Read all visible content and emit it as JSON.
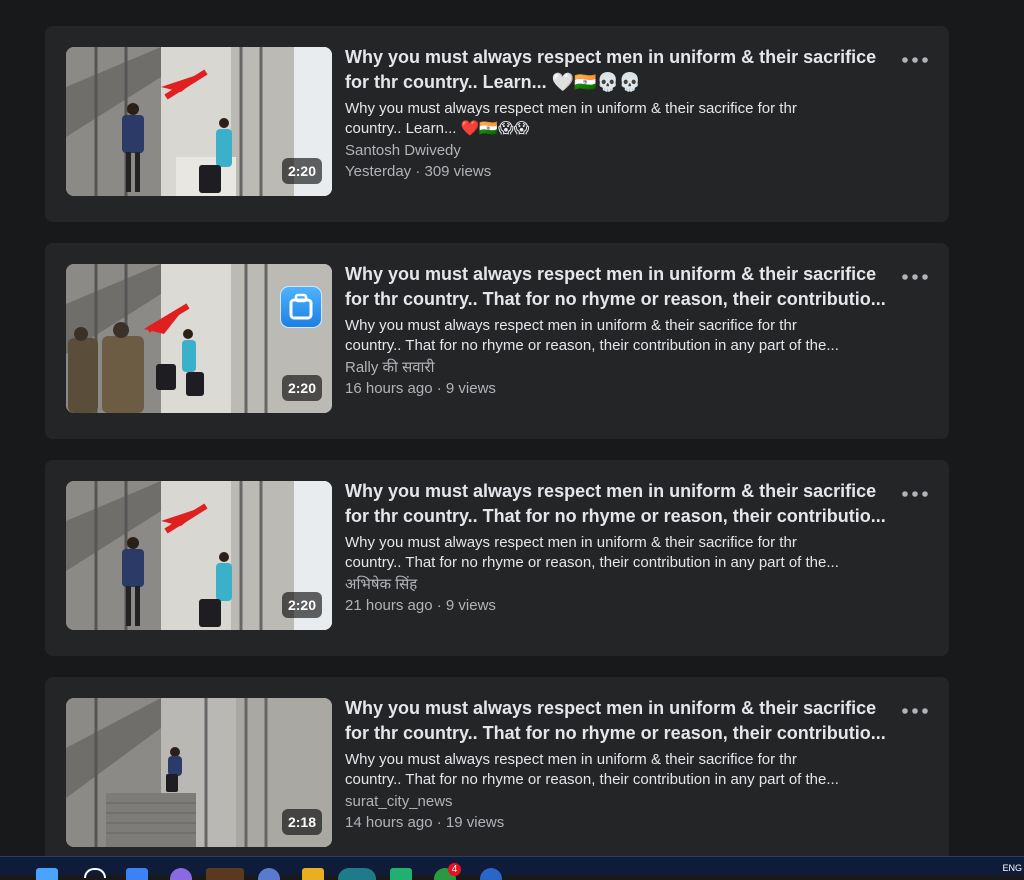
{
  "videos": [
    {
      "title": "Why you must always respect men in uniform & their sacrifice for thr country.. Learn... 🤍🇮🇳💀💀",
      "title_line1": "Why you must always respect men in uniform & their sacrifice",
      "title_line2": "for thr country.. Learn... 🤍🇮🇳💀💀",
      "desc_line1": "Why you must always respect men in uniform & their sacrifice for thr",
      "desc_line2": "country.. Learn... ❤️🇮🇳😱😱",
      "channel": "Santosh Dwivedy",
      "meta": "Yesterday · 309 views",
      "duration": "2:20"
    },
    {
      "title_line1": "Why you must always respect men in uniform & their sacrifice",
      "title_line2": "for thr country.. That for no rhyme or reason, their contributio...",
      "desc_line1": "Why you must always respect men in uniform & their sacrifice for thr",
      "desc_line2": "country.. That for no rhyme or reason, their contribution in any part of the...",
      "channel": "Rally की सवारी",
      "meta": "16 hours ago · 9 views",
      "duration": "2:20"
    },
    {
      "title_line1": "Why you must always respect men in uniform & their sacrifice",
      "title_line2": "for thr country.. That for no rhyme or reason, their contributio...",
      "desc_line1": "Why you must always respect men in uniform & their sacrifice for thr",
      "desc_line2": "country.. That for no rhyme or reason, their contribution in any part of the...",
      "channel": "अभिषेक सिंह",
      "meta": "21 hours ago · 9 views",
      "duration": "2:20"
    },
    {
      "title_line1": "Why you must always respect men in uniform & their sacrifice",
      "title_line2": "for thr country.. That for no rhyme or reason, their contributio...",
      "desc_line1": "Why you must always respect men in uniform & their sacrifice for thr",
      "desc_line2": "country.. That for no rhyme or reason, their contribution in any part of the...",
      "channel": "surat_city_news",
      "meta": "14 hours ago · 19 views",
      "duration": "2:18"
    }
  ],
  "taskbar": {
    "notification_count": "4",
    "language": "ENG"
  },
  "colors": {
    "page_bg": "#18191a",
    "card_bg": "#242526",
    "primary_text": "#e4e6eb",
    "secondary_text": "#b0b3b8",
    "arrow_red": "#e02020"
  }
}
